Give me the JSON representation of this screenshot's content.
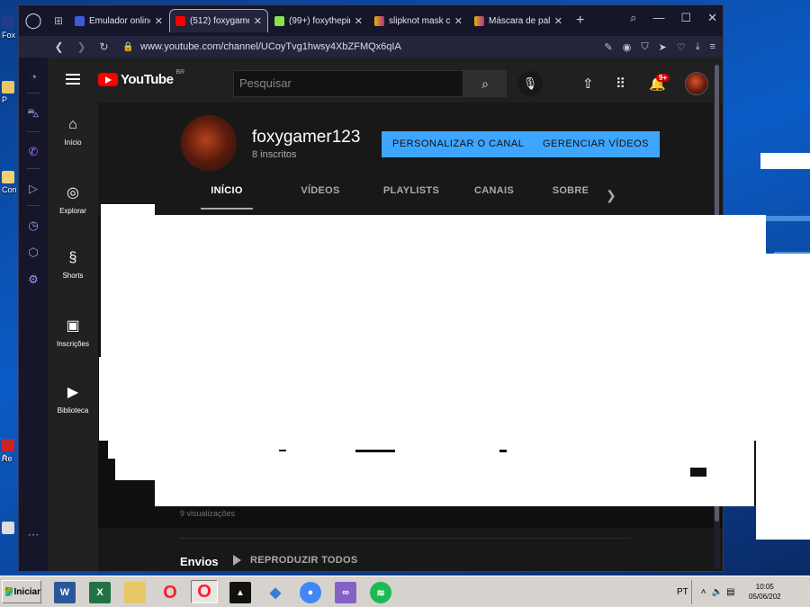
{
  "desktop": {
    "icons": [
      "Fox",
      "P",
      "Con",
      "A",
      "Re"
    ]
  },
  "browser": {
    "tabs": [
      {
        "label": "Emulador online",
        "fav": "#3a5bdc",
        "active": false
      },
      {
        "label": "(512) foxygamer",
        "fav": "#ff0000",
        "active": true
      },
      {
        "label": "(99+) foxythepir",
        "fav": "#8be04e",
        "active": false
      },
      {
        "label": "slipknot mask cl",
        "fav": "#e6b400",
        "active": false
      },
      {
        "label": "Máscara de palh",
        "fav": "#e6b400",
        "active": false
      }
    ],
    "url": "www.youtube.com/channel/UCoyTvg1hwsy4XbZFMQx6qIA"
  },
  "youtube": {
    "logo_text": "YouTube",
    "country_code": "BR",
    "search_placeholder": "Pesquisar",
    "notification_badge": "9+",
    "nav": [
      {
        "label": "Início",
        "icon": "home-icon",
        "glyph": "⌂"
      },
      {
        "label": "Explorar",
        "icon": "compass-icon",
        "glyph": "◎"
      },
      {
        "label": "Shorts",
        "icon": "shorts-icon",
        "glyph": "§"
      },
      {
        "label": "Inscrições",
        "icon": "subscriptions-icon",
        "glyph": "▣"
      },
      {
        "label": "Biblioteca",
        "icon": "library-icon",
        "glyph": "▶"
      }
    ],
    "channel": {
      "name": "foxygamer123",
      "subscribers": "8 inscritos",
      "customize_label": "PERSONALIZAR O CANAL",
      "manage_label": "GERENCIAR VÍDEOS"
    },
    "channel_tabs": [
      "INÍCIO",
      "VÍDEOS",
      "PLAYLISTS",
      "CANAIS",
      "SOBRE"
    ],
    "views_text": "9 visualizações",
    "section_title": "Envios",
    "play_all": "REPRODUZIR TODOS"
  },
  "taskbar": {
    "start_label": "Iniciar",
    "apps": [
      {
        "name": "word-icon",
        "glyph": "W",
        "color": "#2b579a"
      },
      {
        "name": "excel-icon",
        "glyph": "X",
        "color": "#217346"
      },
      {
        "name": "folder-icon",
        "glyph": "",
        "color": "#e8c766"
      },
      {
        "name": "opera-icon",
        "glyph": "O",
        "color": "#ff1b2d"
      },
      {
        "name": "opera-gx-icon",
        "glyph": "O",
        "color": "#ff1b2d"
      },
      {
        "name": "app-black-icon",
        "glyph": "▲",
        "color": "#111111"
      },
      {
        "name": "network-icon",
        "glyph": "◆",
        "color": "#3a7bd5"
      },
      {
        "name": "chrome-icon",
        "glyph": "●",
        "color": "#4285f4"
      },
      {
        "name": "visual-studio-icon",
        "glyph": "∞",
        "color": "#8661c5"
      },
      {
        "name": "spotify-icon",
        "glyph": "≋",
        "color": "#1db954"
      }
    ],
    "language": "PT",
    "time": "10:05",
    "date": "05/06/202"
  }
}
